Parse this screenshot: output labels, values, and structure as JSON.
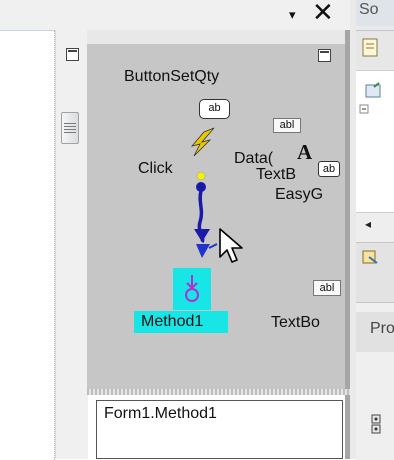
{
  "window": {
    "dropdown_glyph": "▾",
    "close_glyph": "✕",
    "right_panel_title": "So"
  },
  "canvas": {
    "button_label": "ButtonSetQty",
    "button_control_text": "ab",
    "event_label": "Click",
    "data_label": "Data(",
    "textb_label": "TextB",
    "easyg_label": "EasyG",
    "textbox_label": "TextBo",
    "abl_1": "abl",
    "abl_2": "abl",
    "ab_small": "ab",
    "a_glyph": "A",
    "method_label": "Method1"
  },
  "output": {
    "text": "Form1.Method1"
  },
  "right_panel": {
    "scroll_left_glyph": "◂",
    "properties_label": "Pro"
  },
  "colors": {
    "selection_highlight": "#18e6e6",
    "connector_blue": "#1a1aa8",
    "event_lightning": "#e8c800",
    "method_icon": "#b030d0"
  },
  "icons": {
    "minimize_left": "minimize-box-icon",
    "minimize_right": "minimize-box-icon",
    "scroll_grip": "scroll-grip-icon",
    "event": "lightning-icon",
    "method": "method-node-icon",
    "cursor": "mouse-pointer-icon"
  }
}
